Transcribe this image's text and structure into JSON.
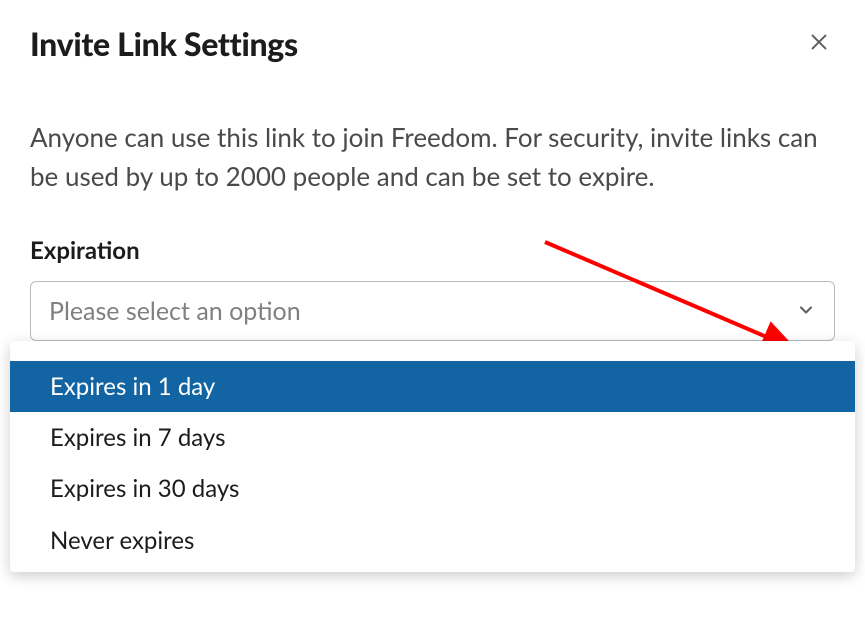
{
  "dialog": {
    "title": "Invite Link Settings",
    "description": "Anyone can use this link to join Freedom. For security, invite links can be used by up to 2000 people and can be set to expire.",
    "expiration_label": "Expiration",
    "select_placeholder": "Please select an option",
    "options": [
      "Expires in 1 day",
      "Expires in 7 days",
      "Expires in 30 days",
      "Never expires"
    ],
    "selected_index": 0,
    "annotation_color": "#ff0000"
  }
}
